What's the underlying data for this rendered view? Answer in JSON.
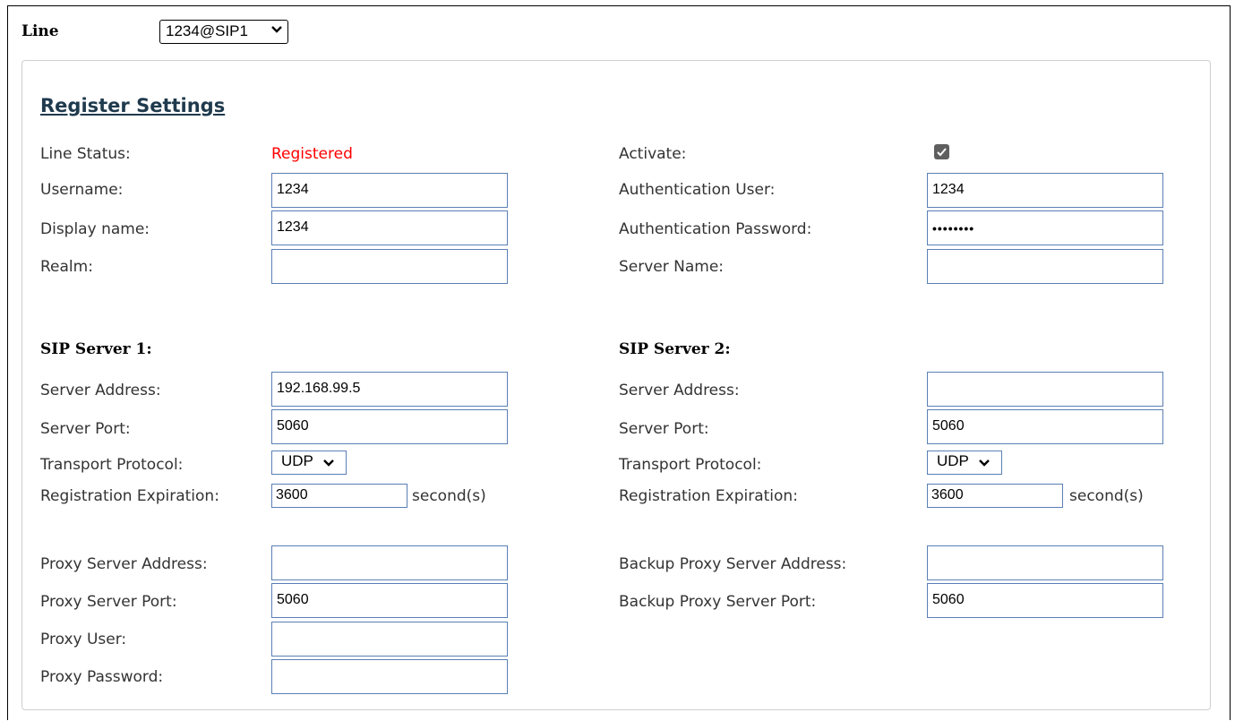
{
  "line": {
    "label": "Line",
    "selected": "1234@SIP1"
  },
  "section": {
    "title": "Register Settings"
  },
  "register": {
    "line_status_label": "Line Status:",
    "line_status_value": "Registered",
    "activate_label": "Activate:",
    "activate_checked": true,
    "username_label": "Username:",
    "username_value": "1234",
    "auth_user_label": "Authentication User:",
    "auth_user_value": "1234",
    "display_name_label": "Display name:",
    "display_name_value": "1234",
    "auth_password_label": "Authentication Password:",
    "auth_password_value": "••••••••",
    "realm_label": "Realm:",
    "realm_value": "",
    "server_name_label": "Server Name:",
    "server_name_value": ""
  },
  "sip1": {
    "title": "SIP Server 1:",
    "address_label": "Server Address:",
    "address_value": "192.168.99.5",
    "port_label": "Server Port:",
    "port_value": "5060",
    "transport_label": "Transport Protocol:",
    "transport_value": "UDP",
    "expiration_label": "Registration Expiration:",
    "expiration_value": "3600",
    "expiration_unit": "second(s)"
  },
  "sip2": {
    "title": "SIP Server 2:",
    "address_label": "Server Address:",
    "address_value": "",
    "port_label": "Server Port:",
    "port_value": "5060",
    "transport_label": "Transport Protocol:",
    "transport_value": "UDP",
    "expiration_label": "Registration Expiration:",
    "expiration_value": "3600",
    "expiration_unit": "second(s)"
  },
  "proxy": {
    "address_label": "Proxy Server Address:",
    "address_value": "",
    "port_label": "Proxy Server Port:",
    "port_value": "5060",
    "user_label": "Proxy User:",
    "user_value": "",
    "password_label": "Proxy Password:",
    "password_value": ""
  },
  "backup_proxy": {
    "address_label": "Backup Proxy Server Address:",
    "address_value": "",
    "port_label": "Backup Proxy Server Port:",
    "port_value": "5060"
  },
  "colors": {
    "status_registered": "#ff0000",
    "input_border": "#5a7fb5",
    "title": "#1f3a4d"
  },
  "icons": {
    "dropdown": "chevron-down-icon",
    "checkbox": "checkmark-icon"
  }
}
